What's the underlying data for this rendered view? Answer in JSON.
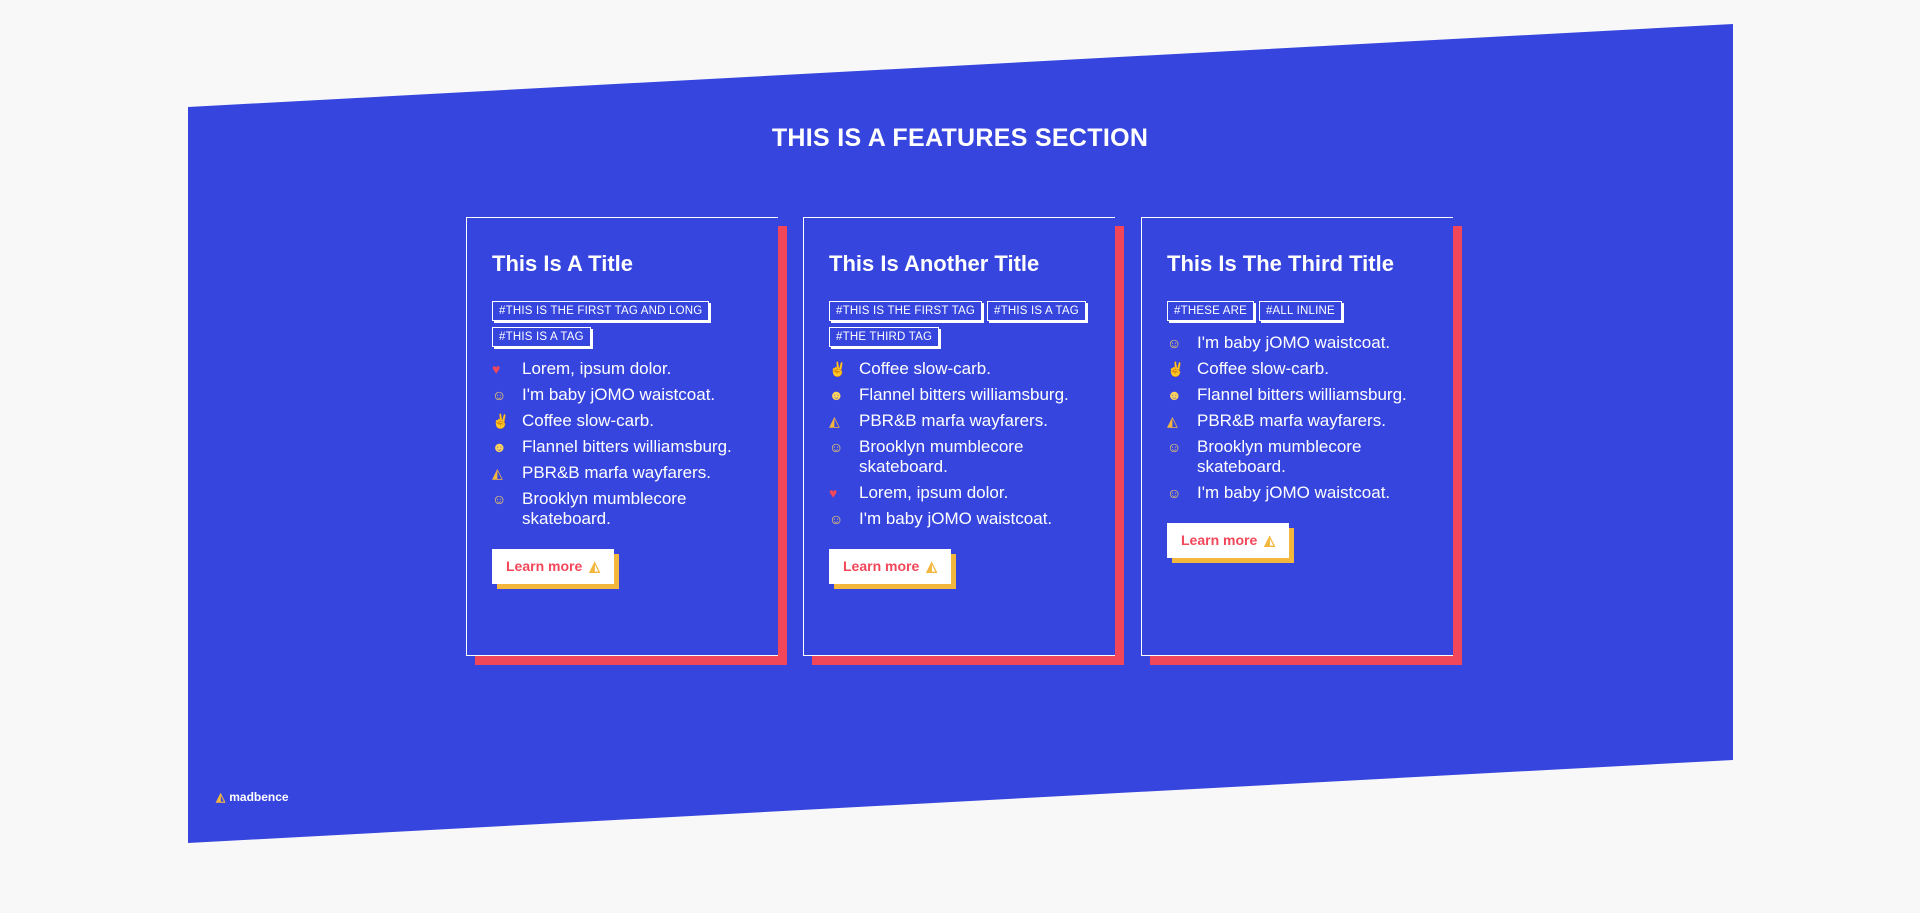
{
  "section": {
    "title": "THIS IS A FEATURES SECTION"
  },
  "cards": [
    {
      "title": "This Is A Title",
      "tags": [
        "#THIS IS THE FIRST TAG AND LONG",
        "#THIS IS A TAG"
      ],
      "items": [
        {
          "icon": "heart-icon",
          "glyph": "♥",
          "text": "Lorem, ipsum dolor."
        },
        {
          "icon": "grinning-face-icon",
          "glyph": "☺",
          "text": "I'm baby jOMO waistcoat."
        },
        {
          "icon": "ok-hand-icon",
          "glyph": "✌",
          "text": "Coffee slow-carb."
        },
        {
          "icon": "star-eyes-face-icon",
          "glyph": "☻",
          "text": "Flannel bitters williamsburg."
        },
        {
          "icon": "pizza-icon",
          "glyph": "◭",
          "text": "PBR&B marfa wayfarers."
        },
        {
          "icon": "grinning-face-icon",
          "glyph": "☺",
          "text": "Brooklyn mumblecore skateboard."
        }
      ],
      "button": "Learn more"
    },
    {
      "title": "This Is Another Title",
      "tags": [
        "#THIS IS THE FIRST TAG",
        "#THIS IS A TAG",
        "#THE THIRD TAG"
      ],
      "items": [
        {
          "icon": "ok-hand-icon",
          "glyph": "✌",
          "text": "Coffee slow-carb."
        },
        {
          "icon": "star-eyes-face-icon",
          "glyph": "☻",
          "text": "Flannel bitters williamsburg."
        },
        {
          "icon": "pizza-icon",
          "glyph": "◭",
          "text": "PBR&B marfa wayfarers."
        },
        {
          "icon": "grinning-face-icon",
          "glyph": "☺",
          "text": "Brooklyn mumblecore skateboard."
        },
        {
          "icon": "heart-icon",
          "glyph": "♥",
          "text": "Lorem, ipsum dolor."
        },
        {
          "icon": "grinning-face-icon",
          "glyph": "☺",
          "text": "I'm baby jOMO waistcoat."
        }
      ],
      "button": "Learn more"
    },
    {
      "title": "This Is The Third Title",
      "tags": [
        "#THESE ARE",
        "#ALL INLINE"
      ],
      "items": [
        {
          "icon": "grinning-face-icon",
          "glyph": "☺",
          "text": "I'm baby jOMO waistcoat."
        },
        {
          "icon": "ok-hand-icon",
          "glyph": "✌",
          "text": "Coffee slow-carb."
        },
        {
          "icon": "star-eyes-face-icon",
          "glyph": "☻",
          "text": "Flannel bitters williamsburg."
        },
        {
          "icon": "pizza-icon",
          "glyph": "◭",
          "text": "PBR&B marfa wayfarers."
        },
        {
          "icon": "grinning-face-icon",
          "glyph": "☺",
          "text": "Brooklyn mumblecore skateboard."
        },
        {
          "icon": "grinning-face-icon",
          "glyph": "☺",
          "text": "I'm baby jOMO waistcoat."
        }
      ],
      "button": "Learn more"
    }
  ],
  "brand": {
    "icon": "pizza-icon",
    "name": "madbence"
  },
  "colors": {
    "background": "#f8f8f9",
    "section": "#3645de",
    "accent": "#f2475a",
    "button_shadow": "#f4b73d",
    "text": "#ffffff"
  }
}
